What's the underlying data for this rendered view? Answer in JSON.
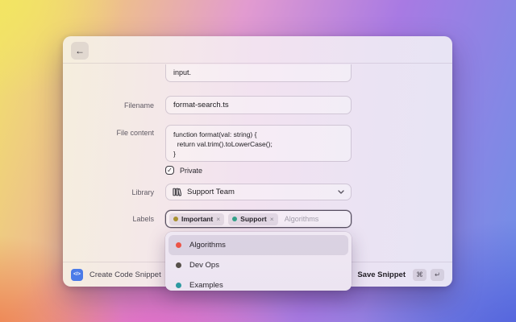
{
  "header": {
    "back_label": "←"
  },
  "form": {
    "description": {
      "visible_text": "input."
    },
    "filename": {
      "label": "Filename",
      "value": "format-search.ts"
    },
    "file_content": {
      "label": "File content",
      "code": "function format(val: string) {\n  return val.trim().toLowerCase();\n}"
    },
    "private": {
      "label": "Private",
      "checked": true,
      "check_glyph": "✓"
    },
    "library": {
      "label": "Library",
      "value": "Support Team"
    },
    "labels": {
      "label": "Labels",
      "tags": [
        {
          "text": "Important",
          "color": "#a8912f",
          "remove_glyph": "×"
        },
        {
          "text": "Support",
          "color": "#35a189",
          "remove_glyph": "×"
        }
      ],
      "typed_text": "Algorithms"
    }
  },
  "dropdown": {
    "items": [
      {
        "label": "Algorithms",
        "color": "#ec5447",
        "selected": true
      },
      {
        "label": "Dev Ops",
        "color": "#56504a",
        "selected": false
      },
      {
        "label": "Examples",
        "color": "#2d9aa1",
        "selected": false
      }
    ]
  },
  "footer": {
    "app_name": "Create Code Snippet",
    "app_icon_glyph": "</>",
    "app_icon_color": "#4b7be8",
    "action_label": "Save Snippet",
    "shortcuts": [
      "⌘",
      "↵"
    ]
  }
}
